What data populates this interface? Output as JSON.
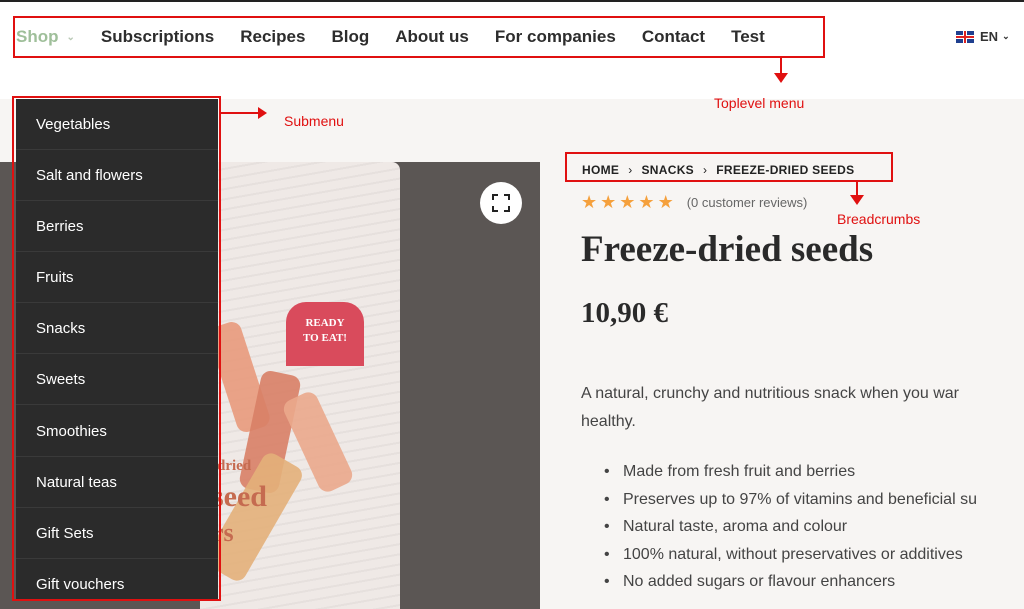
{
  "nav": {
    "items": [
      "Shop",
      "Subscriptions",
      "Recipes",
      "Blog",
      "About us",
      "For companies",
      "Contact",
      "Test"
    ],
    "active_item": "Shop",
    "language": "EN"
  },
  "submenu": {
    "items": [
      "Vegetables",
      "Salt and flowers",
      "Berries",
      "Fruits",
      "Snacks",
      "Sweets",
      "Smoothies",
      "Natural teas",
      "Gift Sets",
      "Gift vouchers"
    ]
  },
  "annotations": {
    "submenu": "Submenu",
    "toplevel": "Toplevel menu",
    "breadcrumbs": "Breadcrumbs"
  },
  "breadcrumb": [
    "HOME",
    "SNACKS",
    "FREEZE-DRIED SEEDS"
  ],
  "product": {
    "rating_stars": 5,
    "reviews": "(0 customer reviews)",
    "title": "Freeze-dried seeds",
    "price": "10,90 €",
    "description": "A natural, crunchy and nutritious snack when you want something healthy.",
    "desc_line1": "A natural, crunchy and nutritious snack when you war",
    "desc_line2": "healthy.",
    "bullets": [
      "Made from fresh fruit and berries",
      "Preserves up to 97% of vitamins and beneficial su",
      "Natural taste, aroma and colour",
      "100% natural, without preservatives or additives",
      "No added sugars or flavour enhancers"
    ],
    "package_badge": [
      "READY",
      "TO EAT!"
    ],
    "package_text": [
      "-dried",
      "seed",
      "rs"
    ]
  },
  "colors": {
    "accent_red": "#e01010",
    "active_nav": "#9fbf9a",
    "star": "#f5a03c",
    "submenu_bg": "#2b2b2b"
  },
  "icons": {
    "zoom": "fullscreen-icon",
    "flag": "uk-flag-icon",
    "star": "star-icon"
  }
}
